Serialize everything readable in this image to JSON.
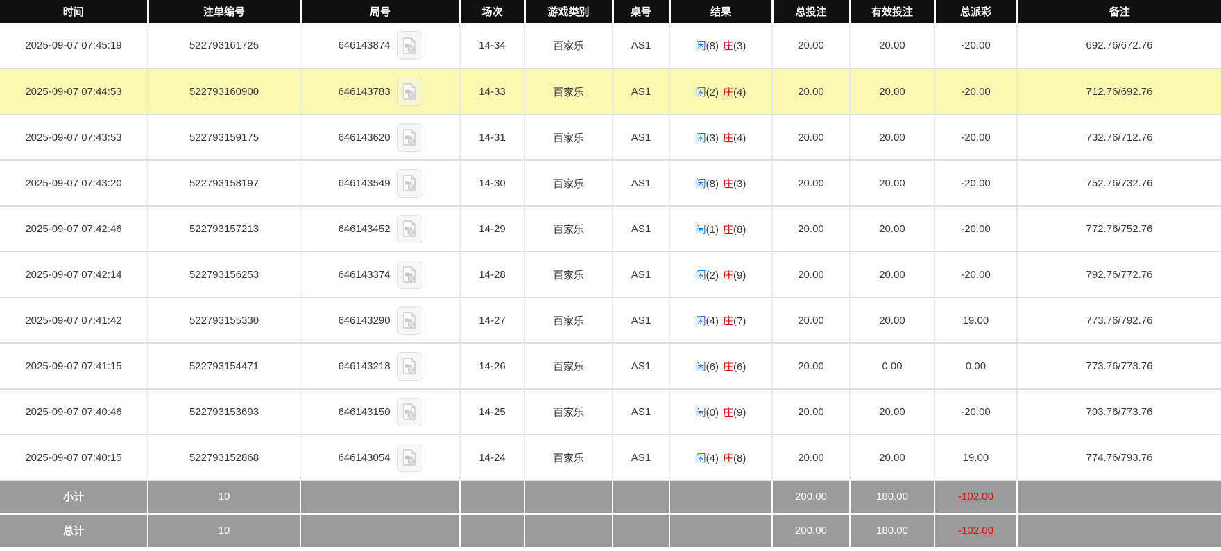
{
  "colors": {
    "header_bg": "#101010",
    "highlight_row": "#f9f9b4",
    "summary_bg": "#9b9b9b",
    "bet_amount_blue": "#1a6fe8",
    "loss_red": "#e60000",
    "player_blue": "#1a6fe8",
    "banker_red": "#e60000"
  },
  "icons": {
    "round_video": "video-file-icon"
  },
  "headers": [
    {
      "key": "time",
      "label": "时间"
    },
    {
      "key": "bet_id",
      "label": "注单编号"
    },
    {
      "key": "round_id",
      "label": "局号"
    },
    {
      "key": "session",
      "label": "场次"
    },
    {
      "key": "game_type",
      "label": "游戏类别"
    },
    {
      "key": "table_no",
      "label": "桌号"
    },
    {
      "key": "result",
      "label": "结果"
    },
    {
      "key": "total_bet",
      "label": "总投注"
    },
    {
      "key": "valid_bet",
      "label": "有效投注"
    },
    {
      "key": "payout",
      "label": "总派彩"
    },
    {
      "key": "remark",
      "label": "备注"
    }
  ],
  "rows": [
    {
      "time": "2025-09-07 07:45:19",
      "bet_id": "522793161725",
      "round_id": "646143874",
      "session": "14-34",
      "game_type": "百家乐",
      "table_no": "AS1",
      "result": {
        "player": "闲",
        "player_pts": "(8)",
        "banker": "庄",
        "banker_pts": "(3)"
      },
      "total_bet": "20.00",
      "valid_bet": "20.00",
      "payout": "-20.00",
      "remark": "692.76/672.76"
    },
    {
      "time": "2025-09-07 07:44:53",
      "bet_id": "522793160900",
      "round_id": "646143783",
      "session": "14-33",
      "game_type": "百家乐",
      "table_no": "AS1",
      "result": {
        "player": "闲",
        "player_pts": "(2)",
        "banker": "庄",
        "banker_pts": "(4)"
      },
      "total_bet": "20.00",
      "valid_bet": "20.00",
      "payout": "-20.00",
      "remark": "712.76/692.76"
    },
    {
      "time": "2025-09-07 07:43:53",
      "bet_id": "522793159175",
      "round_id": "646143620",
      "session": "14-31",
      "game_type": "百家乐",
      "table_no": "AS1",
      "result": {
        "player": "闲",
        "player_pts": "(3)",
        "banker": "庄",
        "banker_pts": "(4)"
      },
      "total_bet": "20.00",
      "valid_bet": "20.00",
      "payout": "-20.00",
      "remark": "732.76/712.76"
    },
    {
      "time": "2025-09-07 07:43:20",
      "bet_id": "522793158197",
      "round_id": "646143549",
      "session": "14-30",
      "game_type": "百家乐",
      "table_no": "AS1",
      "result": {
        "player": "闲",
        "player_pts": "(8)",
        "banker": "庄",
        "banker_pts": "(3)"
      },
      "total_bet": "20.00",
      "valid_bet": "20.00",
      "payout": "-20.00",
      "remark": "752.76/732.76"
    },
    {
      "time": "2025-09-07 07:42:46",
      "bet_id": "522793157213",
      "round_id": "646143452",
      "session": "14-29",
      "game_type": "百家乐",
      "table_no": "AS1",
      "result": {
        "player": "闲",
        "player_pts": "(1)",
        "banker": "庄",
        "banker_pts": "(8)"
      },
      "total_bet": "20.00",
      "valid_bet": "20.00",
      "payout": "-20.00",
      "remark": "772.76/752.76"
    },
    {
      "time": "2025-09-07 07:42:14",
      "bet_id": "522793156253",
      "round_id": "646143374",
      "session": "14-28",
      "game_type": "百家乐",
      "table_no": "AS1",
      "result": {
        "player": "闲",
        "player_pts": "(2)",
        "banker": "庄",
        "banker_pts": "(9)"
      },
      "total_bet": "20.00",
      "valid_bet": "20.00",
      "payout": "-20.00",
      "remark": "792.76/772.76"
    },
    {
      "time": "2025-09-07 07:41:42",
      "bet_id": "522793155330",
      "round_id": "646143290",
      "session": "14-27",
      "game_type": "百家乐",
      "table_no": "AS1",
      "result": {
        "player": "闲",
        "player_pts": "(4)",
        "banker": "庄",
        "banker_pts": "(7)"
      },
      "total_bet": "20.00",
      "valid_bet": "20.00",
      "payout": "19.00",
      "remark": "773.76/792.76"
    },
    {
      "time": "2025-09-07 07:41:15",
      "bet_id": "522793154471",
      "round_id": "646143218",
      "session": "14-26",
      "game_type": "百家乐",
      "table_no": "AS1",
      "result": {
        "player": "闲",
        "player_pts": "(6)",
        "banker": "庄",
        "banker_pts": "(6)"
      },
      "total_bet": "20.00",
      "valid_bet": "0.00",
      "payout": "0.00",
      "remark": "773.76/773.76"
    },
    {
      "time": "2025-09-07 07:40:46",
      "bet_id": "522793153693",
      "round_id": "646143150",
      "session": "14-25",
      "game_type": "百家乐",
      "table_no": "AS1",
      "result": {
        "player": "闲",
        "player_pts": "(0)",
        "banker": "庄",
        "banker_pts": "(9)"
      },
      "total_bet": "20.00",
      "valid_bet": "20.00",
      "payout": "-20.00",
      "remark": "793.76/773.76"
    },
    {
      "time": "2025-09-07 07:40:15",
      "bet_id": "522793152868",
      "round_id": "646143054",
      "session": "14-24",
      "game_type": "百家乐",
      "table_no": "AS1",
      "result": {
        "player": "闲",
        "player_pts": "(4)",
        "banker": "庄",
        "banker_pts": "(8)"
      },
      "total_bet": "20.00",
      "valid_bet": "20.00",
      "payout": "19.00",
      "remark": "774.76/793.76"
    }
  ],
  "summary": {
    "subtotal": {
      "label": "小计",
      "count": "10",
      "total_bet": "200.00",
      "valid_bet": "180.00",
      "payout": "-102.00"
    },
    "grand_total": {
      "label": "总计",
      "count": "10",
      "total_bet": "200.00",
      "valid_bet": "180.00",
      "payout": "-102.00"
    }
  }
}
